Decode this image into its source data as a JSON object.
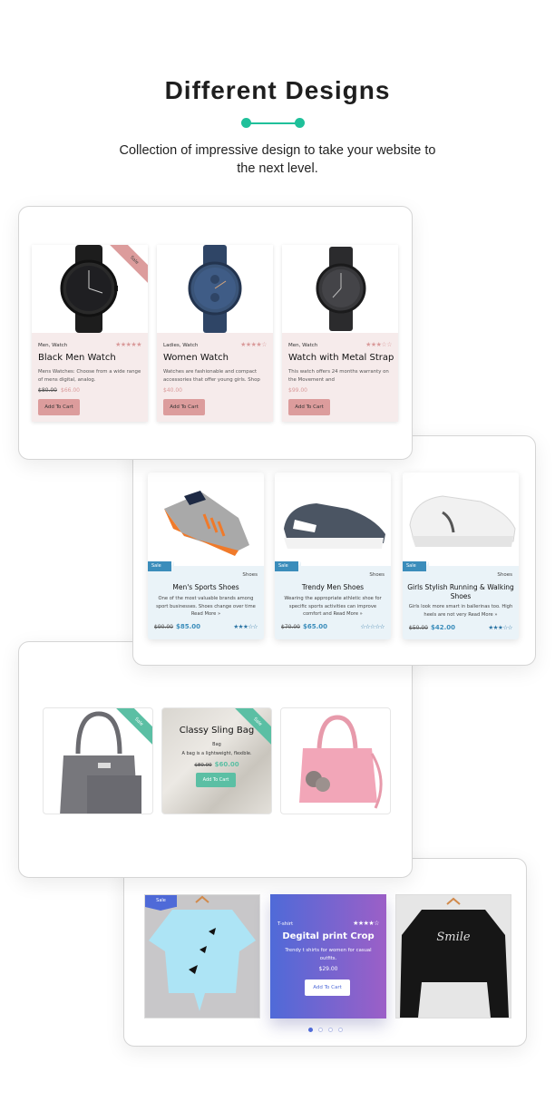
{
  "header": {
    "title": "Different Designs",
    "subtitle": "Collection of impressive design to take your website to the next level.",
    "accent_color": "#1fc09a"
  },
  "watches": {
    "accent_color": "#dc9c9c",
    "items": [
      {
        "category": "Men, Watch",
        "rating": 5,
        "stars": "★★★★★",
        "name": "Black Men Watch",
        "description": "Mens Watches: Choose from a wide range of mens digital, analog.",
        "old_price": "$80.00",
        "price": "$66.00",
        "button": "Add To Cart",
        "badge": "Sale"
      },
      {
        "category": "Ladies, Watch",
        "rating": 4,
        "stars": "★★★★☆",
        "name": "Women Watch",
        "description": "Watches  are fashionable and compact accessories that offer young girls. Shop",
        "price": "$40.00",
        "button": "Add To Cart"
      },
      {
        "category": "Men, Watch",
        "rating": 3,
        "stars": "★★★☆☆",
        "name": "Watch with Metal Strap",
        "description": "This watch offers 24 months warranty on the Movement and",
        "price": "$99.00",
        "button": "Add To Cart"
      }
    ]
  },
  "shoes": {
    "accent_color": "#3b8dbb",
    "items": [
      {
        "badge": "Sale",
        "category": "Shoes",
        "name": "Men's Sports Shoes",
        "description": "One of the most valuable brands among sport businesses. Shoes change over time",
        "read_more": "Read More »",
        "old_price": "$90.00",
        "price": "$85.00",
        "rating": 3,
        "stars": "★★★☆☆"
      },
      {
        "badge": "Sale",
        "category": "Shoes",
        "name": "Trendy Men Shoes",
        "description": "Wearing the appropriate athletic shoe for specific sports activities can improve comfort and",
        "read_more": "Read More »",
        "old_price": "$70.00",
        "price": "$65.00",
        "rating": 0,
        "stars": "☆☆☆☆☆"
      },
      {
        "badge": "Sale",
        "category": "Shoes",
        "name": "Girls Stylish Running & Walking Shoes",
        "description": "Girls look more smart in ballerinas too. High heels are not very",
        "read_more": "Read More »",
        "old_price": "$50.00",
        "price": "$42.00",
        "rating": 3,
        "stars": "★★★☆☆"
      }
    ]
  },
  "bags": {
    "accent_color": "#5bbfa4",
    "items": [
      {
        "badge": "Sale",
        "image": "grey-handbag"
      },
      {
        "badge": "Sale",
        "name": "Classy Sling Bag",
        "category": "Bag",
        "description": "A bag is a lightweight, flexible.",
        "old_price": "$80.00",
        "price": "$60.00",
        "button": "Add To Cart",
        "stars": "☆☆"
      },
      {
        "image": "pink-handbag"
      }
    ]
  },
  "tshirts": {
    "accent_color": "#4f6ad8",
    "items": [
      {
        "badge": "Sale",
        "image": "blue-butterfly-crop-top"
      },
      {
        "category": "T-shirt",
        "rating": 4,
        "stars": "★★★★☆",
        "name": "Degital print Crop",
        "description": "Trendy t shirts for women for casual outfits.",
        "price": "$29.00",
        "button": "Add To Cart"
      },
      {
        "image": "black-smile-sweatshirt",
        "print_text": "Smile"
      }
    ],
    "pagination": {
      "total": 4,
      "active": 1
    }
  }
}
